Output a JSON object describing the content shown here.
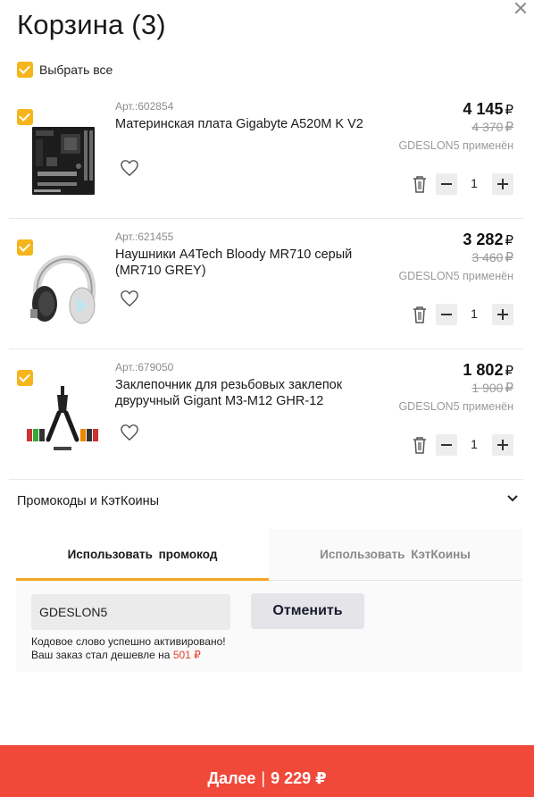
{
  "header": {
    "title": "Корзина (3)"
  },
  "select_all": {
    "label": "Выбрать все",
    "checked": true
  },
  "items": [
    {
      "article": "Арт.:602854",
      "name": "Материнская плата Gigabyte A520M K V2",
      "price": "4 145",
      "old_price": "4 370",
      "currency": "₽",
      "promo_note": "GDESLON5 применён",
      "quantity": "1",
      "image_icon": "motherboard-image"
    },
    {
      "article": "Арт.:621455",
      "name": "Наушники A4Tech Bloody MR710 серый (MR710 GREY)",
      "price": "3 282",
      "old_price": "3 460",
      "currency": "₽",
      "promo_note": "GDESLON5 применён",
      "quantity": "1",
      "image_icon": "headphones-image"
    },
    {
      "article": "Арт.:679050",
      "name": "Заклепочник для резьбовых заклепок двуручный Gigant M3-M12 GHR-12",
      "price": "1 802",
      "old_price": "1 900",
      "currency": "₽",
      "promo_note": "GDESLON5 применён",
      "quantity": "1",
      "image_icon": "riveter-image"
    }
  ],
  "promo": {
    "header": "Промокоды и КэтКоины",
    "tabs": [
      "Использовать  промокод",
      "Использовать  КэтКоины"
    ],
    "input_value": "GDESLON5",
    "cancel_label": "Отменить",
    "message_line1": "Кодовое слово успешно активировано!",
    "message_line2": "Ваш заказ стал дешевле на",
    "discount": "501 ₽"
  },
  "footer": {
    "label": "Далее",
    "separator": "|",
    "total": "9 229 ₽"
  },
  "colors": {
    "accent": "#f5b51b",
    "primary_button": "#f0493a",
    "tab_underline": "#f5a623",
    "discount": "#e8412d"
  }
}
